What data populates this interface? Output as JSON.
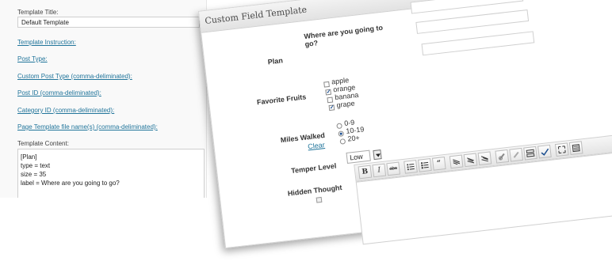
{
  "settings": {
    "template_title_label": "Template Title:",
    "template_title_value": "Default Template",
    "links": [
      "Template Instruction:",
      "Post Type:",
      "Custom Post Type (comma-deliminated):",
      "Post ID (comma-deliminated):",
      "Category ID (comma-deliminated):",
      "Page Template file name(s) (comma-deliminated):"
    ],
    "template_content_label": "Template Content:",
    "template_content_lines": [
      "[Plan]",
      "type = text",
      "size = 35",
      "label = Where are you going to go?"
    ]
  },
  "cft": {
    "title": "Custom Field Template",
    "question": "Where are you going to go?",
    "plan_label": "Plan",
    "favorite_fruits_label": "Favorite Fruits",
    "fruits": [
      {
        "label": "apple",
        "checked": false
      },
      {
        "label": "orange",
        "checked": true
      },
      {
        "label": "banana",
        "checked": false
      },
      {
        "label": "grape",
        "checked": true
      }
    ],
    "miles_walked_label": "Miles Walked",
    "clear_label": "Clear",
    "miles_options": [
      {
        "label": "0-9",
        "selected": false
      },
      {
        "label": "10-19",
        "selected": true
      },
      {
        "label": "20+",
        "selected": false
      }
    ],
    "temper_level_label": "Temper Level",
    "temper_value": "Low",
    "hidden_thought_label": "Hidden Thought",
    "toolbar": {
      "bold": "B",
      "italic": "I",
      "strike": "abc"
    }
  }
}
